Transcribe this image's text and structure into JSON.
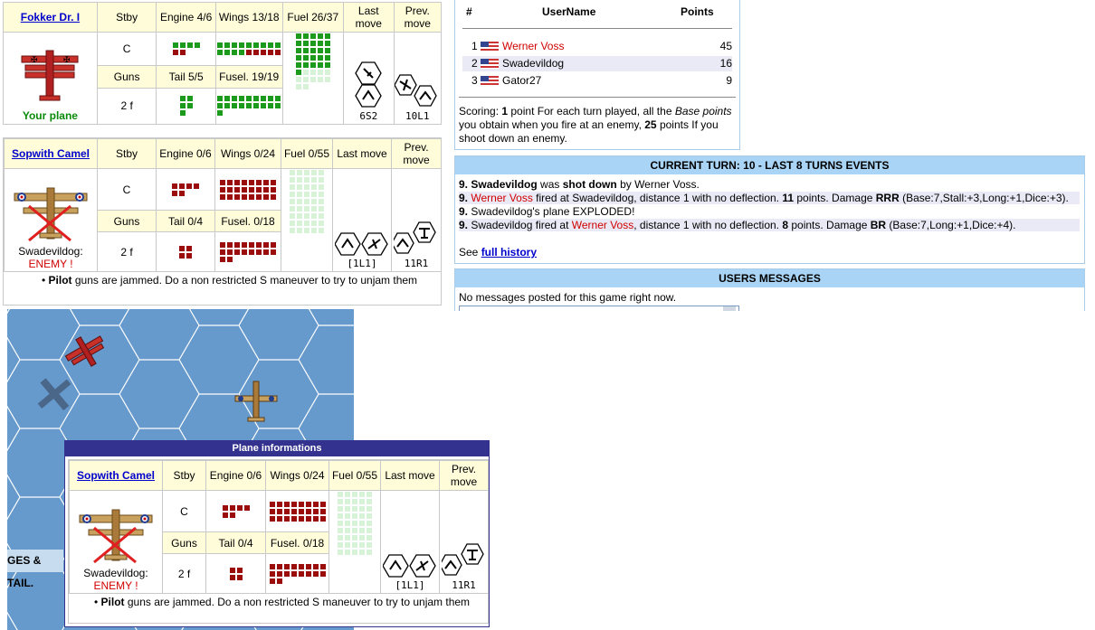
{
  "own_plane": {
    "name": "Fokker Dr. I",
    "caption": "Your plane",
    "stby_label": "Stby",
    "stby_value": "C",
    "engine_label": "Engine 4/6",
    "wings_label": "Wings 13/18",
    "fuel_label": "Fuel 26/37",
    "last_move_label": "Last move",
    "prev_move_label": "Prev. move",
    "guns_label": "Guns",
    "guns_value": "2 f",
    "tail_label": "Tail 5/5",
    "fusel_label": "Fusel. 19/19",
    "last_move_code": "6S2",
    "prev_move_code": "10L1"
  },
  "enemy_plane": {
    "name": "Sopwith Camel",
    "owner": "Swadevildog:",
    "status": "ENEMY !",
    "stby_label": "Stby",
    "stby_value": "C",
    "engine_label": "Engine 0/6",
    "wings_label": "Wings 0/24",
    "fuel_label": "Fuel 0/55",
    "last_move_label": "Last move",
    "prev_move_label": "Prev. move",
    "guns_label": "Guns",
    "guns_value": "2 f",
    "tail_label": "Tail 0/4",
    "fusel_label": "Fusel. 0/18",
    "last_move_code": "[1L1]",
    "prev_move_code": "11R1",
    "note_bold": "Pilot",
    "note_text": " guns are jammed. Do a non restricted S maneuver to try to unjam them"
  },
  "scores": {
    "col_num": "#",
    "col_user": "UserName",
    "col_points": "Points",
    "rows": [
      {
        "rank": "1",
        "user": "Werner Voss",
        "points": "45"
      },
      {
        "rank": "2",
        "user": "Swadevildog",
        "points": "16"
      },
      {
        "rank": "3",
        "user": "Gator27",
        "points": "9"
      }
    ],
    "scoring_prefix": "Scoring: ",
    "scoring_b1": "1",
    "scoring_t1": " point For each turn played, all the ",
    "scoring_i1": "Base points",
    "scoring_t2": " you obtain when you fire at an enemy, ",
    "scoring_b2": "25",
    "scoring_t3": " points If you shoot down an enemy."
  },
  "events": {
    "title": "CURRENT TURN: 10 - LAST 8 TURNS EVENTS",
    "e1_num": "9.",
    "e1_name": "Swadevildog",
    "e1_t1": " was ",
    "e1_b": "shot down",
    "e1_t2": " by Werner Voss.",
    "e2_num": "9.",
    "e2_name": "Werner Voss",
    "e2_t1": " fired at Swadevildog, distance 1 with no deflection. ",
    "e2_pts": "11",
    "e2_t2": " points. Damage ",
    "e2_dmg": "RRR",
    "e2_t3": " (Base:7,Stall:+3,Long:+1,Dice:+3).",
    "e3_num": "9.",
    "e3_text": " Swadevildog's plane EXPLODED!",
    "e4_num": "9.",
    "e4_t1": " Swadevildog fired at ",
    "e4_name": "Werner Voss",
    "e4_t2": ", distance 1 with no deflection. ",
    "e4_pts": "8",
    "e4_t3": " points. Damage ",
    "e4_dmg": "BR",
    "e4_t4": " (Base:7,Long:+1,Dice:+4).",
    "see": "See ",
    "history_link": "full history"
  },
  "messages": {
    "title": "USERS MESSAGES",
    "empty_text": "No messages posted for this game right now."
  },
  "map": {
    "side_label": "GES & TAIL."
  },
  "popup": {
    "title": "Plane informations"
  },
  "colors": {
    "header_bg": "#fffcd9",
    "bar_blue": "#a9d4f5",
    "map_blue": "#6699cc",
    "popup_title_bg": "#33338f",
    "green_square": "#1b9a1b",
    "red_square": "#9b0d0d"
  }
}
